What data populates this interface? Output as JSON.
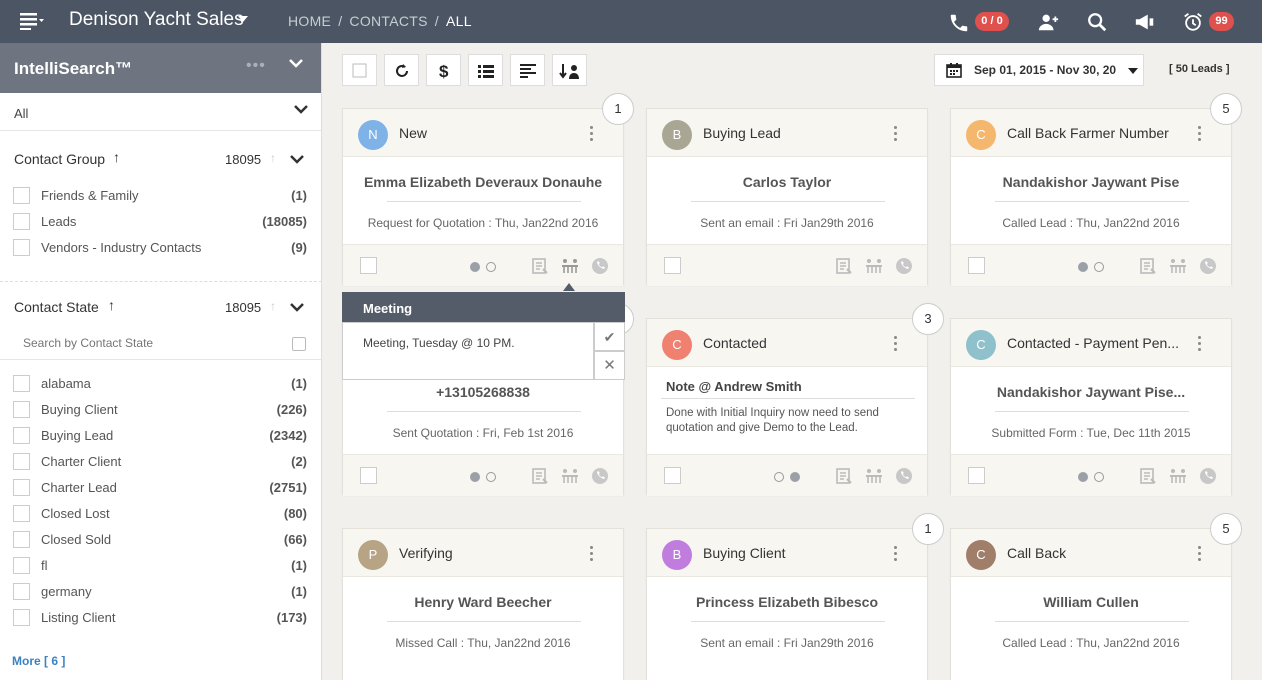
{
  "header": {
    "app_title": "Denison Yacht Sales",
    "breadcrumb": [
      "HOME",
      "CONTACTS",
      "ALL"
    ],
    "call_badge": "0 / 0",
    "alarm_badge": "99",
    "icons": [
      "menu-icon",
      "phone-icon",
      "add-user-icon",
      "search-icon",
      "megaphone-icon",
      "alarm-clock-icon"
    ]
  },
  "sidebar": {
    "title": "IntelliSearch™",
    "dots": "•••",
    "filter_all": "All",
    "contact_group": {
      "title": "Contact Group",
      "count": "18095",
      "items": [
        {
          "label": "Friends & Family",
          "count": "(1)"
        },
        {
          "label": "Leads",
          "count": "(18085)"
        },
        {
          "label": "Vendors - Industry Contacts",
          "count": "(9)"
        }
      ]
    },
    "contact_state": {
      "title": "Contact State",
      "count": "18095",
      "search_placeholder": "Search by Contact State",
      "items": [
        {
          "label": "alabama",
          "count": "(1)"
        },
        {
          "label": "Buying Client",
          "count": "(226)"
        },
        {
          "label": "Buying Lead",
          "count": "(2342)"
        },
        {
          "label": "Charter Client",
          "count": "(2)"
        },
        {
          "label": "Charter Lead",
          "count": "(2751)"
        },
        {
          "label": "Closed Lost",
          "count": "(80)"
        },
        {
          "label": "Closed Sold",
          "count": "(66)"
        },
        {
          "label": "fl",
          "count": "(1)"
        },
        {
          "label": "germany",
          "count": "(1)"
        },
        {
          "label": "Listing Client",
          "count": "(173)"
        }
      ]
    },
    "more": "More [ 6 ]"
  },
  "toolbar": {
    "buttons": [
      "select-all",
      "refresh-icon",
      "dollar-icon",
      "list-icon",
      "align-icon",
      "sort-person-icon"
    ],
    "date_range": "Sep 01, 2015 - Nov 30, 20",
    "lead_count": "[ 50 Leads ]"
  },
  "cards": [
    {
      "status": "New",
      "initial": "N",
      "color": "#7fb3e8",
      "name": "Emma Elizabeth Deveraux Donauhe",
      "activity": "Request for Quotation :  Thu, Jan22nd 2016",
      "badge": "1",
      "dots": [
        true,
        false
      ]
    },
    {
      "status": "Buying Lead",
      "initial": "B",
      "color": "#a9a693",
      "name": "Carlos Taylor",
      "activity": "Sent an email :  Fri Jan29th 2016",
      "badge": "",
      "dots": []
    },
    {
      "status": "Call Back Farmer Number",
      "initial": "C",
      "color": "#f5b66e",
      "name": "Nandakishor Jaywant Pise",
      "activity": "Called Lead :   Thu, Jan22nd 2016",
      "badge": "5",
      "dots": [
        true,
        false
      ]
    },
    {
      "status": "",
      "initial": "",
      "color": "",
      "name": "+13105268838",
      "activity": "Sent Quotation :   Fri, Feb 1st 2016",
      "badge": "",
      "dots": [
        true,
        false
      ]
    },
    {
      "status": "Contacted",
      "initial": "C",
      "color": "#f08070",
      "name": "",
      "activity": "",
      "badge": "3",
      "dots": [
        false,
        true
      ],
      "note_title": "Note @ Andrew Smith",
      "note_body": "Done with Initial Inquiry now need to send quotation and give Demo to the Lead."
    },
    {
      "status": "Contacted - Payment Pen...",
      "initial": "C",
      "color": "#8ec1cb",
      "name": "Nandakishor Jaywant Pise...",
      "activity": "Submitted Form :   Tue, Dec 11th 2015",
      "badge": "",
      "dots": [
        true,
        false
      ]
    },
    {
      "status": "Verifying",
      "initial": "P",
      "color": "#b6a484",
      "name": "Henry Ward Beecher",
      "activity": "Missed Call  :   Thu, Jan22nd 2016",
      "badge": "",
      "dots": []
    },
    {
      "status": "Buying Client",
      "initial": "B",
      "color": "#c07ddd",
      "name": "Princess Elizabeth Bibesco",
      "activity": "Sent an email :  Fri Jan29th 2016",
      "badge": "1",
      "dots": []
    },
    {
      "status": "Call Back",
      "initial": "C",
      "color": "#a07e6a",
      "name": "William Cullen",
      "activity": "Called Lead :   Thu, Jan22nd 2016",
      "badge": "5",
      "dots": []
    }
  ],
  "meeting_popup": {
    "title": "Meeting",
    "text": "Meeting, Tuesday @ 10 PM.",
    "ok": "✔",
    "cancel": "✕"
  }
}
